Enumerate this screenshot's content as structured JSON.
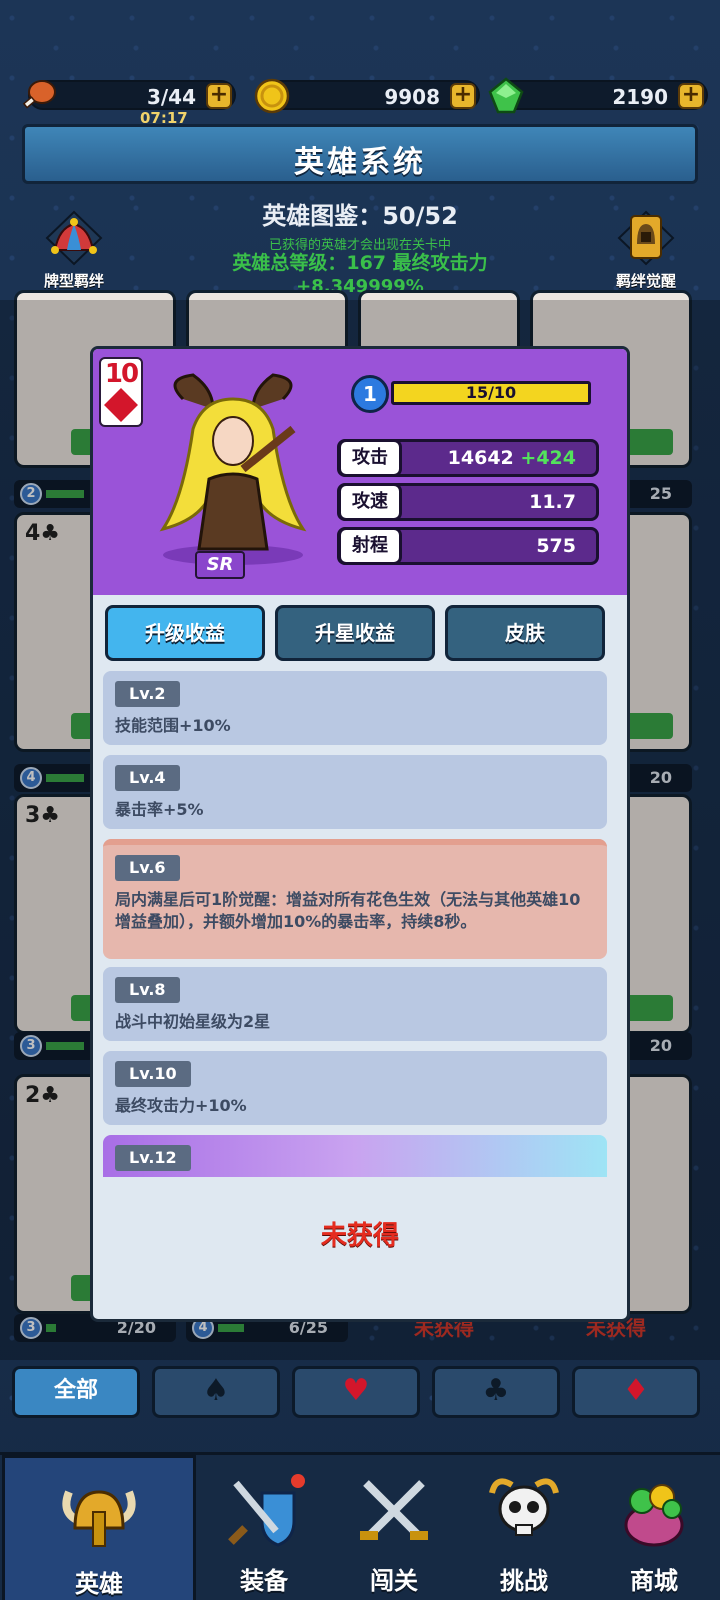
{
  "resources": {
    "stamina": "3/44",
    "timer": "07:17",
    "gold": "9908",
    "gems": "2190",
    "plus_label": "+"
  },
  "header": {
    "title": "英雄系统",
    "collection": "英雄图鉴：50/52",
    "note": "已获得的英雄才会出现在关卡中",
    "total_level": "英雄总等级：167   最终攻击力",
    "bonus": "+8.349999%",
    "left_button": "牌型羁绊",
    "right_button": "羁绊觉醒"
  },
  "bg_cards": {
    "suits": [
      "4♣",
      "3♣",
      "2♣"
    ],
    "levels": [
      {
        "lv": "2",
        "text": ""
      },
      {
        "lv": "4",
        "text": ""
      },
      {
        "lv": "3",
        "text": ""
      },
      {
        "lv": "3",
        "text": "2/20"
      },
      {
        "lv": "4",
        "text": "6/25"
      }
    ],
    "right_texts": [
      "25",
      "20",
      "20"
    ],
    "unobtained": "未获得"
  },
  "modal": {
    "card_rank": "10",
    "rarity": "SR",
    "level": "1",
    "xp": "15/10",
    "stats": [
      {
        "label": "攻击",
        "value": "14642",
        "bonus": "+424"
      },
      {
        "label": "攻速",
        "value": "11.7",
        "bonus": ""
      },
      {
        "label": "射程",
        "value": "575",
        "bonus": ""
      }
    ],
    "tabs": [
      "升级收益",
      "升星收益",
      "皮肤"
    ],
    "perks": [
      {
        "lv": "Lv.2",
        "desc": "技能范围+10%"
      },
      {
        "lv": "Lv.4",
        "desc": "暴击率+5%"
      },
      {
        "lv": "Lv.6",
        "desc": "局内满星后可1阶觉醒：增益对所有花色生效（无法与其他英雄10增益叠加），并额外增加10%的暴击率，持续8秒。"
      },
      {
        "lv": "Lv.8",
        "desc": "战斗中初始星级为2星"
      },
      {
        "lv": "Lv.10",
        "desc": "最终攻击力+10%"
      },
      {
        "lv": "Lv.12",
        "desc": ""
      }
    ],
    "status": "未获得"
  },
  "filters": {
    "all": "全部",
    "spade": "♠",
    "heart": "♥",
    "club": "♣",
    "diamond": "♦"
  },
  "nav": [
    "英雄",
    "装备",
    "闯关",
    "挑战",
    "商城"
  ],
  "colors": {
    "accent_purple": "#9a53d8",
    "gold": "#e8b62c",
    "green": "#3ac04a",
    "red": "#e52c1f"
  }
}
